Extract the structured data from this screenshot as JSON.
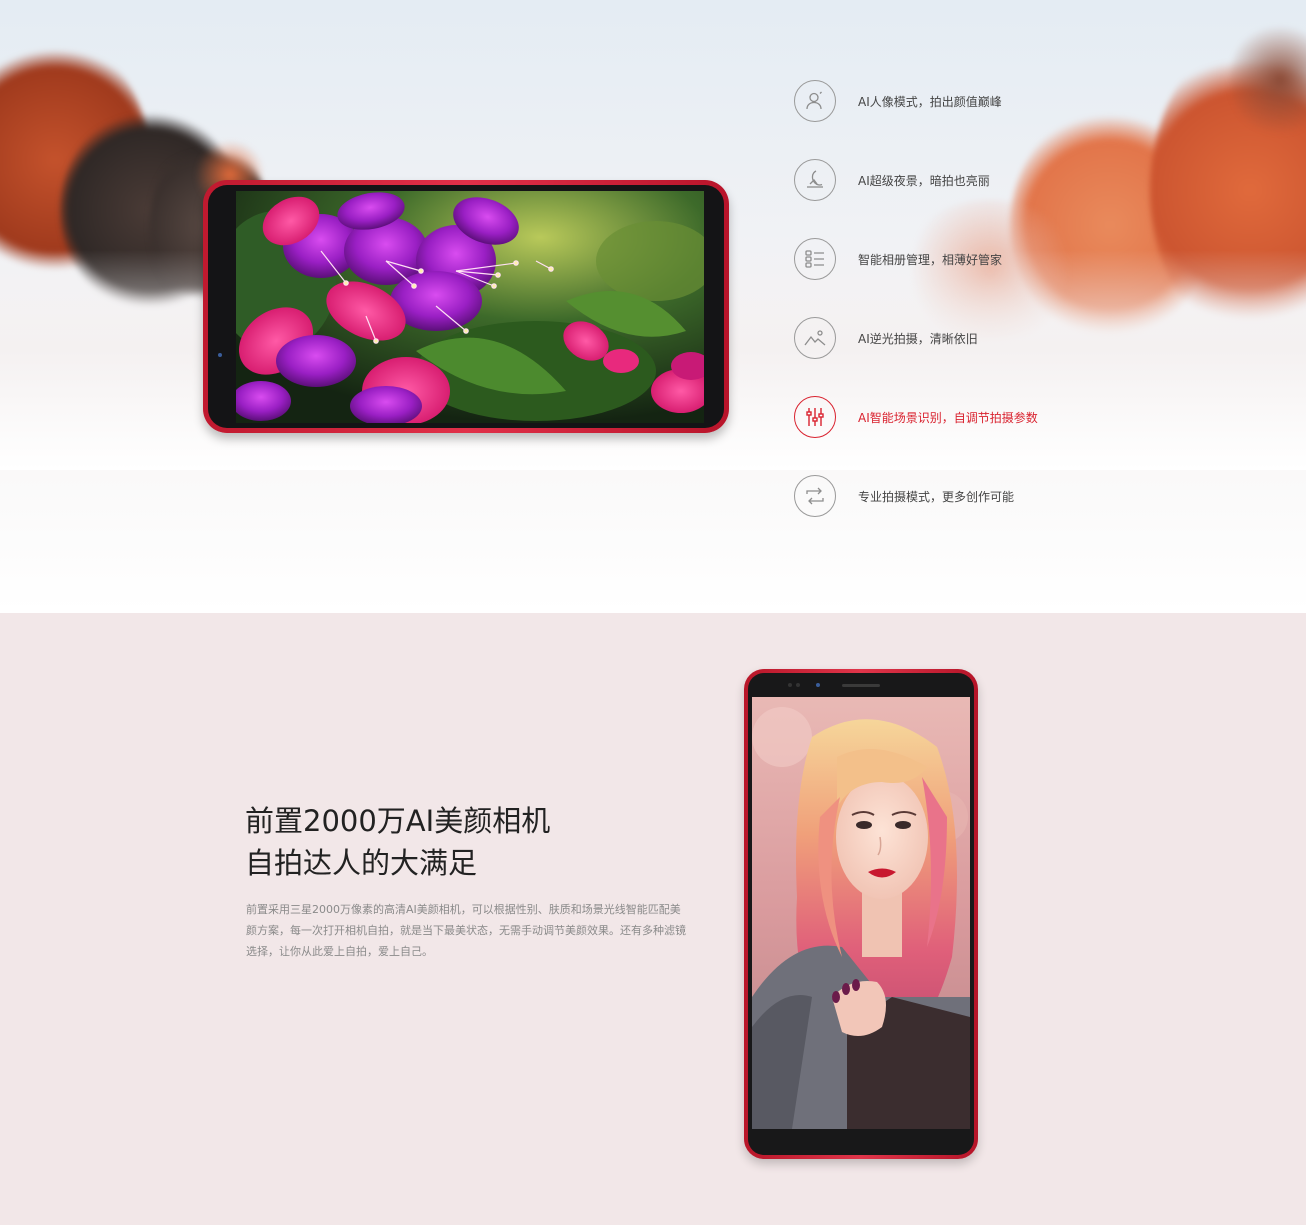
{
  "features": [
    {
      "icon": "portrait-person-icon",
      "label": "AI人像模式，拍出颜值巅峰",
      "active": false
    },
    {
      "icon": "night-moon-icon",
      "label": "AI超级夜景，暗拍也亮丽",
      "active": false
    },
    {
      "icon": "album-list-icon",
      "label": "智能相册管理，相薄好管家",
      "active": false
    },
    {
      "icon": "backlight-mountain-icon",
      "label": "AI逆光拍摄，清晰依旧",
      "active": false
    },
    {
      "icon": "scene-sliders-icon",
      "label": "AI智能场景识别，自调节拍摄参数",
      "active": true
    },
    {
      "icon": "pro-mode-swap-icon",
      "label": "专业拍摄模式，更多创作可能",
      "active": false
    }
  ],
  "selfie": {
    "title_line1": "前置2000万AI美颜相机",
    "title_line2": "自拍达人的大满足",
    "description": "前置采用三星2000万像素的高清AI美颜相机，可以根据性别、肤质和场景光线智能匹配美颜方案，每一次打开相机自拍，就是当下最美状态，无需手动调节美颜效果。还有多种滤镜选择，让你从此爱上自拍，爱上自己。"
  },
  "colors": {
    "accent": "#d9222f",
    "phone_body": "#d02539",
    "section2_bg": "#f2e7e8",
    "feature_text": "#444444"
  }
}
